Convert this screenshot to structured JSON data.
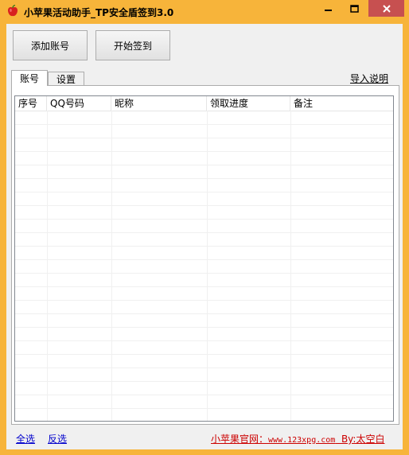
{
  "window": {
    "title": "小苹果活动助手_TP安全盾签到3.0",
    "colors": {
      "frame": "#f7b43a",
      "close": "#c75050",
      "link": "#0000cc",
      "site": "#cc0000"
    }
  },
  "toolbar": {
    "add_account_label": "添加账号",
    "start_signin_label": "开始签到"
  },
  "tabs": [
    {
      "label": "账号",
      "active": true
    },
    {
      "label": "设置",
      "active": false
    }
  ],
  "import_help_label": "导入说明",
  "table": {
    "columns": [
      "序号",
      "QQ号码",
      "昵称",
      "领取进度",
      "备注"
    ],
    "rows": []
  },
  "footer": {
    "select_all_label": "全选",
    "invert_label": "反选",
    "site_prefix": "小苹果官网：",
    "site_url": "www.123xpg.com",
    "site_by": "By:太空白"
  }
}
